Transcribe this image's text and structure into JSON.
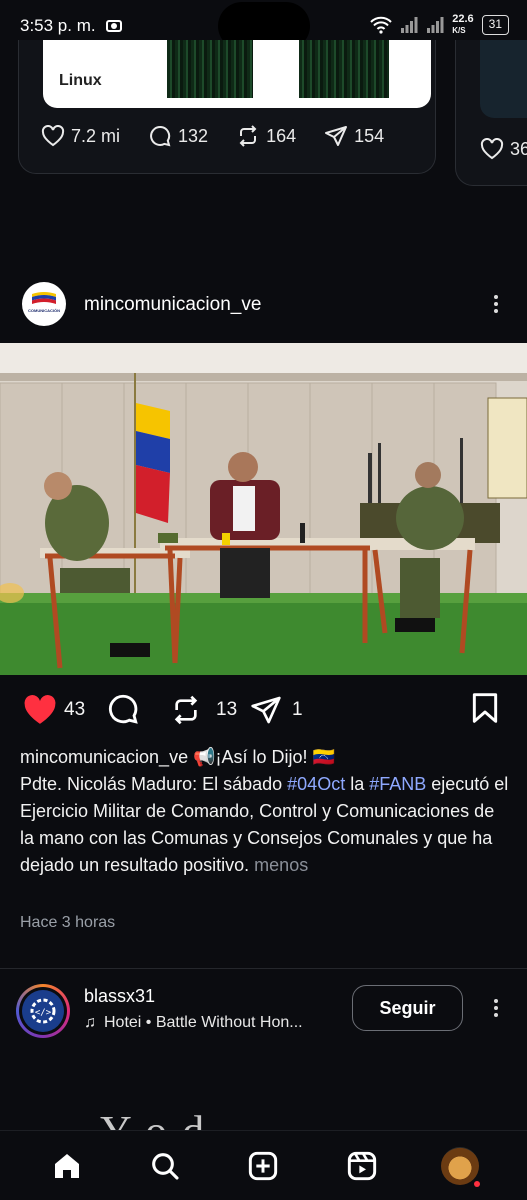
{
  "status_bar": {
    "time": "3:53 p. m.",
    "net_speed_value": "22.6",
    "net_speed_unit": "K/S",
    "battery": "31"
  },
  "prev_post": {
    "card_label": "Linux",
    "likes": "7.2 mi",
    "replies": "132",
    "reposts": "164",
    "shares": "154",
    "next_card_likes": "36"
  },
  "post": {
    "username": "mincomunicacion_ve",
    "avatar_label": "COMUNICACIÓN",
    "likes": "43",
    "reposts": "13",
    "shares": "1",
    "caption_user": "mincomunicacion_ve",
    "caption_head": " 📢¡Así lo Dijo! 🇻🇪",
    "caption_text_1": "Pdte. Nicolás Maduro: El sábado ",
    "hashtag_1": "#04Oct",
    "caption_text_2": " la ",
    "hashtag_2": "#FANB",
    "caption_text_3": " ejecutó el Ejercicio Militar de Comando, Control y Comunicaciones de la mano con las Comunas y Consejos Comunales y que ha dejado un resultado positivo.",
    "more": " menos",
    "time_ago": "Hace 3 horas"
  },
  "next_post": {
    "username": "blassx31",
    "song": "Hotei • Battle Without Hon...",
    "follow_label": "Seguir"
  },
  "colors": {
    "like_red": "#ff3040",
    "hashtag_blue": "#8fa9ff",
    "background": "#0b0c10"
  },
  "nav": [
    "home-icon",
    "search-icon",
    "create-icon",
    "reels-icon",
    "profile-avatar"
  ]
}
